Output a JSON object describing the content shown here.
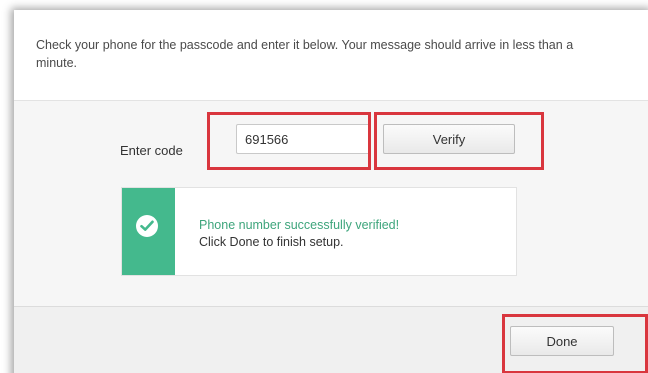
{
  "instructions": "Check your phone for the passcode and enter it below. Your message should arrive in less than a minute.",
  "code_field": {
    "label": "Enter code",
    "value": "691566"
  },
  "verify_button": {
    "label": "Verify"
  },
  "success": {
    "title": "Phone number successfully verified!",
    "subtitle": "Click Done to finish setup.",
    "icon": "check-circle-icon",
    "accent_color": "#44b98d"
  },
  "done_button": {
    "label": "Done"
  },
  "highlight_color": "#d9363e"
}
